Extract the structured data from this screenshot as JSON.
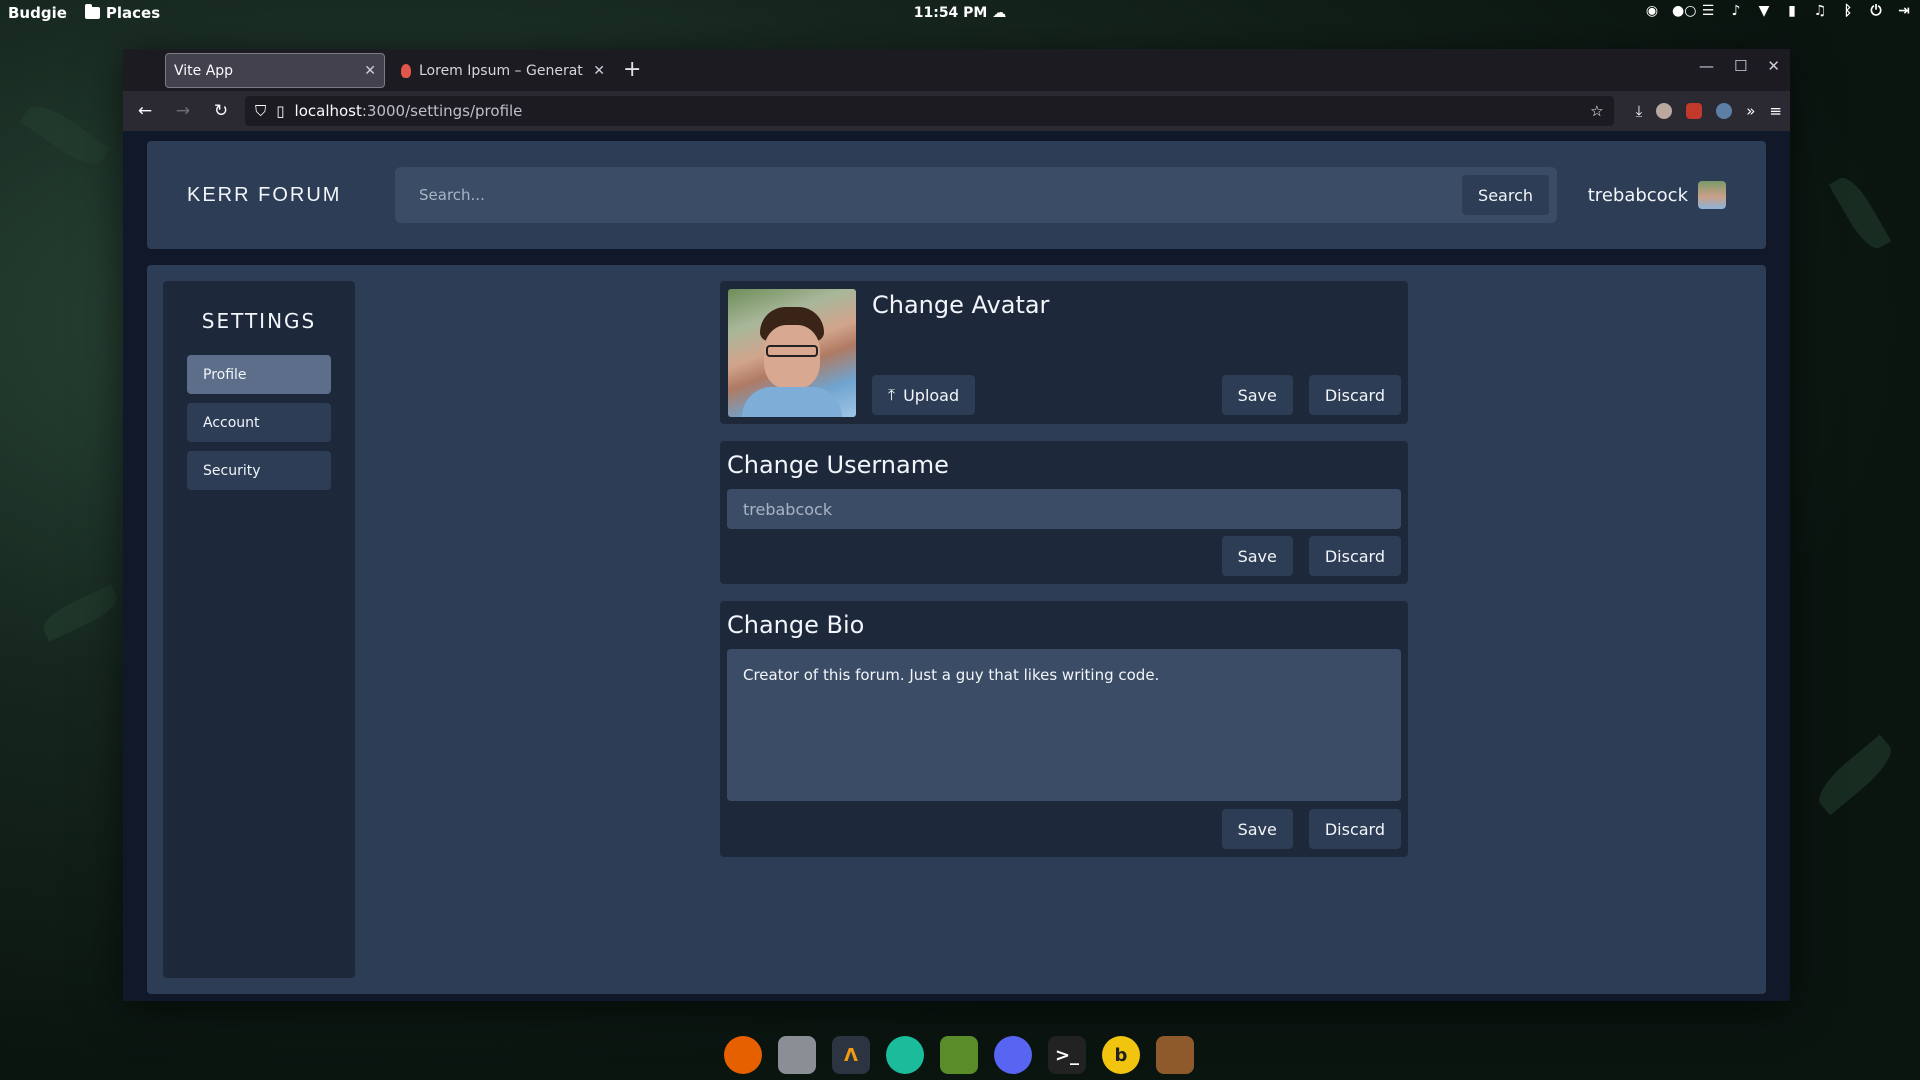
{
  "desktop": {
    "menu_label": "Budgie",
    "places_label": "Places",
    "clock": "11:54 PM"
  },
  "browser": {
    "tabs": [
      {
        "title": "Vite App",
        "active": true
      },
      {
        "title": "Lorem Ipsum – Generat",
        "active": false
      }
    ],
    "url_host": "localhost",
    "url_path": ":3000/settings/profile"
  },
  "app": {
    "brand": "KERR FORUM",
    "search": {
      "placeholder": "Search...",
      "button": "Search"
    },
    "user": {
      "name": "trebabcock"
    }
  },
  "sidebar": {
    "title": "SETTINGS",
    "items": [
      {
        "label": "Profile",
        "active": true
      },
      {
        "label": "Account",
        "active": false
      },
      {
        "label": "Security",
        "active": false
      }
    ]
  },
  "avatar_card": {
    "title": "Change Avatar",
    "upload": "Upload",
    "save": "Save",
    "discard": "Discard"
  },
  "username_card": {
    "title": "Change Username",
    "placeholder": "trebabcock",
    "value": "",
    "save": "Save",
    "discard": "Discard"
  },
  "bio_card": {
    "title": "Change Bio",
    "value": "Creator of this forum. Just a guy that likes writing code.",
    "save": "Save",
    "discard": "Discard"
  },
  "colors": {
    "page_bg": "#10182a",
    "panel": "#2c3d55",
    "card": "#1d283b",
    "input": "#3b4d66",
    "active_nav": "#5c6e89"
  }
}
